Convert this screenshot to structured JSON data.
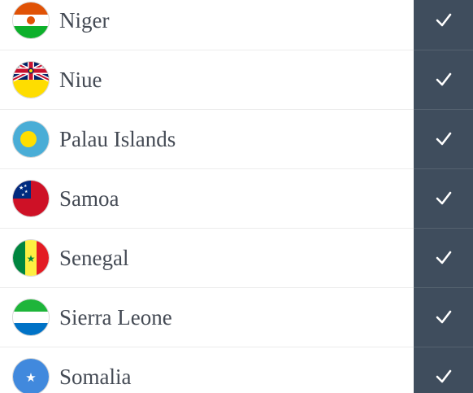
{
  "countries": [
    {
      "name": "Niger",
      "flag_icon": "niger-flag-icon",
      "selected": true
    },
    {
      "name": "Niue",
      "flag_icon": "niue-flag-icon",
      "selected": true
    },
    {
      "name": "Palau Islands",
      "flag_icon": "palau-flag-icon",
      "selected": true
    },
    {
      "name": "Samoa",
      "flag_icon": "samoa-flag-icon",
      "selected": true
    },
    {
      "name": "Senegal",
      "flag_icon": "senegal-flag-icon",
      "selected": true
    },
    {
      "name": "Sierra Leone",
      "flag_icon": "sierra-leone-flag-icon",
      "selected": true
    },
    {
      "name": "Somalia",
      "flag_icon": "somalia-flag-icon",
      "selected": true
    }
  ],
  "colors": {
    "check_bg": "#3f4d5d",
    "text": "#444a54"
  },
  "check_icon": "check-icon"
}
